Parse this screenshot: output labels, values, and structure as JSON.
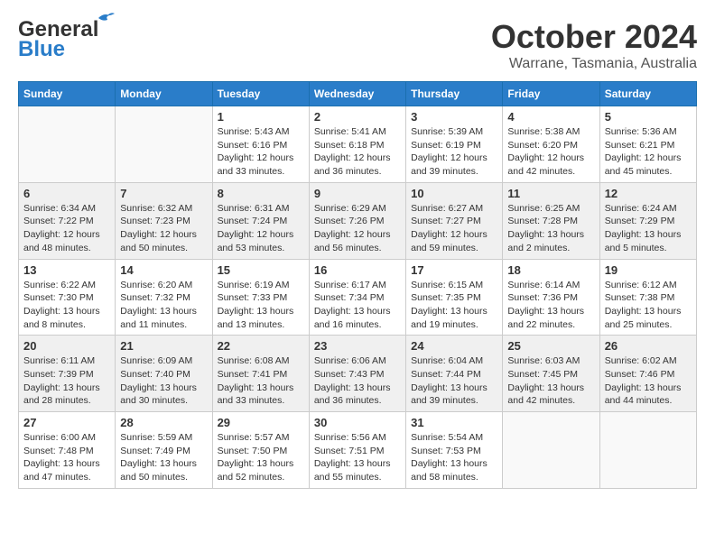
{
  "header": {
    "logo_line1": "General",
    "logo_line2": "Blue",
    "month": "October 2024",
    "location": "Warrane, Tasmania, Australia"
  },
  "weekdays": [
    "Sunday",
    "Monday",
    "Tuesday",
    "Wednesday",
    "Thursday",
    "Friday",
    "Saturday"
  ],
  "weeks": [
    [
      {
        "day": "",
        "info": ""
      },
      {
        "day": "",
        "info": ""
      },
      {
        "day": "1",
        "info": "Sunrise: 5:43 AM\nSunset: 6:16 PM\nDaylight: 12 hours\nand 33 minutes."
      },
      {
        "day": "2",
        "info": "Sunrise: 5:41 AM\nSunset: 6:18 PM\nDaylight: 12 hours\nand 36 minutes."
      },
      {
        "day": "3",
        "info": "Sunrise: 5:39 AM\nSunset: 6:19 PM\nDaylight: 12 hours\nand 39 minutes."
      },
      {
        "day": "4",
        "info": "Sunrise: 5:38 AM\nSunset: 6:20 PM\nDaylight: 12 hours\nand 42 minutes."
      },
      {
        "day": "5",
        "info": "Sunrise: 5:36 AM\nSunset: 6:21 PM\nDaylight: 12 hours\nand 45 minutes."
      }
    ],
    [
      {
        "day": "6",
        "info": "Sunrise: 6:34 AM\nSunset: 7:22 PM\nDaylight: 12 hours\nand 48 minutes."
      },
      {
        "day": "7",
        "info": "Sunrise: 6:32 AM\nSunset: 7:23 PM\nDaylight: 12 hours\nand 50 minutes."
      },
      {
        "day": "8",
        "info": "Sunrise: 6:31 AM\nSunset: 7:24 PM\nDaylight: 12 hours\nand 53 minutes."
      },
      {
        "day": "9",
        "info": "Sunrise: 6:29 AM\nSunset: 7:26 PM\nDaylight: 12 hours\nand 56 minutes."
      },
      {
        "day": "10",
        "info": "Sunrise: 6:27 AM\nSunset: 7:27 PM\nDaylight: 12 hours\nand 59 minutes."
      },
      {
        "day": "11",
        "info": "Sunrise: 6:25 AM\nSunset: 7:28 PM\nDaylight: 13 hours\nand 2 minutes."
      },
      {
        "day": "12",
        "info": "Sunrise: 6:24 AM\nSunset: 7:29 PM\nDaylight: 13 hours\nand 5 minutes."
      }
    ],
    [
      {
        "day": "13",
        "info": "Sunrise: 6:22 AM\nSunset: 7:30 PM\nDaylight: 13 hours\nand 8 minutes."
      },
      {
        "day": "14",
        "info": "Sunrise: 6:20 AM\nSunset: 7:32 PM\nDaylight: 13 hours\nand 11 minutes."
      },
      {
        "day": "15",
        "info": "Sunrise: 6:19 AM\nSunset: 7:33 PM\nDaylight: 13 hours\nand 13 minutes."
      },
      {
        "day": "16",
        "info": "Sunrise: 6:17 AM\nSunset: 7:34 PM\nDaylight: 13 hours\nand 16 minutes."
      },
      {
        "day": "17",
        "info": "Sunrise: 6:15 AM\nSunset: 7:35 PM\nDaylight: 13 hours\nand 19 minutes."
      },
      {
        "day": "18",
        "info": "Sunrise: 6:14 AM\nSunset: 7:36 PM\nDaylight: 13 hours\nand 22 minutes."
      },
      {
        "day": "19",
        "info": "Sunrise: 6:12 AM\nSunset: 7:38 PM\nDaylight: 13 hours\nand 25 minutes."
      }
    ],
    [
      {
        "day": "20",
        "info": "Sunrise: 6:11 AM\nSunset: 7:39 PM\nDaylight: 13 hours\nand 28 minutes."
      },
      {
        "day": "21",
        "info": "Sunrise: 6:09 AM\nSunset: 7:40 PM\nDaylight: 13 hours\nand 30 minutes."
      },
      {
        "day": "22",
        "info": "Sunrise: 6:08 AM\nSunset: 7:41 PM\nDaylight: 13 hours\nand 33 minutes."
      },
      {
        "day": "23",
        "info": "Sunrise: 6:06 AM\nSunset: 7:43 PM\nDaylight: 13 hours\nand 36 minutes."
      },
      {
        "day": "24",
        "info": "Sunrise: 6:04 AM\nSunset: 7:44 PM\nDaylight: 13 hours\nand 39 minutes."
      },
      {
        "day": "25",
        "info": "Sunrise: 6:03 AM\nSunset: 7:45 PM\nDaylight: 13 hours\nand 42 minutes."
      },
      {
        "day": "26",
        "info": "Sunrise: 6:02 AM\nSunset: 7:46 PM\nDaylight: 13 hours\nand 44 minutes."
      }
    ],
    [
      {
        "day": "27",
        "info": "Sunrise: 6:00 AM\nSunset: 7:48 PM\nDaylight: 13 hours\nand 47 minutes."
      },
      {
        "day": "28",
        "info": "Sunrise: 5:59 AM\nSunset: 7:49 PM\nDaylight: 13 hours\nand 50 minutes."
      },
      {
        "day": "29",
        "info": "Sunrise: 5:57 AM\nSunset: 7:50 PM\nDaylight: 13 hours\nand 52 minutes."
      },
      {
        "day": "30",
        "info": "Sunrise: 5:56 AM\nSunset: 7:51 PM\nDaylight: 13 hours\nand 55 minutes."
      },
      {
        "day": "31",
        "info": "Sunrise: 5:54 AM\nSunset: 7:53 PM\nDaylight: 13 hours\nand 58 minutes."
      },
      {
        "day": "",
        "info": ""
      },
      {
        "day": "",
        "info": ""
      }
    ]
  ]
}
